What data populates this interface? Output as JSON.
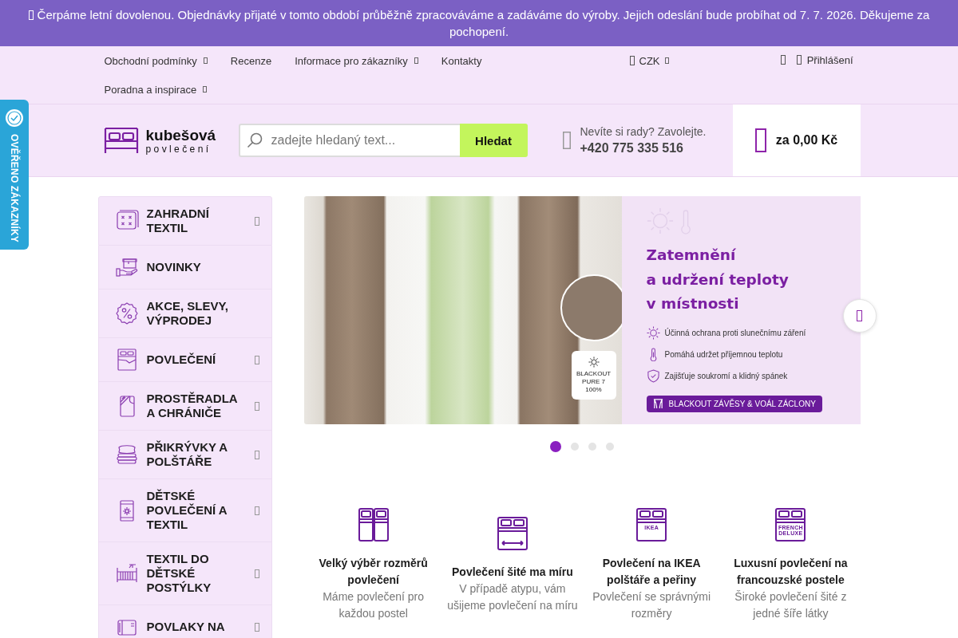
{
  "announcement": {
    "text": "Čerpáme letní dovolenou. Objednávky přijaté v tomto období průběžně zpracováváme a zadáváme do výroby. Jejich odeslání bude probíhat od 7. 7. 2026. Děkujeme za pochopení."
  },
  "top_nav": {
    "links": [
      {
        "label": "Obchodní podmínky",
        "has_submenu": true
      },
      {
        "label": "Recenze",
        "has_submenu": false
      },
      {
        "label": "Informace pro zákazníky",
        "has_submenu": true
      },
      {
        "label": "Kontakty",
        "has_submenu": false
      },
      {
        "label": "Poradna a inspirace",
        "has_submenu": true
      }
    ],
    "currency": "CZK",
    "login": "Přihlášení"
  },
  "verified_tab": {
    "label": "OVĚŘENO ZÁKAZNÍKY"
  },
  "header": {
    "logo": {
      "name": "kubešová",
      "tagline": "povlečení"
    },
    "search": {
      "placeholder": "zadejte hledaný text...",
      "button": "Hledat"
    },
    "contact": {
      "prompt": "Nevíte si rady? Zavolejte.",
      "phone": "+420 775 335 516"
    },
    "cart": {
      "total": "za 0,00 Kč"
    }
  },
  "categories": [
    {
      "kind": "cushion",
      "label": "ZAHRADNÍ TEXTIL",
      "has_submenu": true
    },
    {
      "kind": "parcel",
      "label": "NOVINKY",
      "has_submenu": false
    },
    {
      "kind": "discount",
      "label": "AKCE, SLEVY, VÝPRODEJ",
      "has_submenu": false
    },
    {
      "kind": "bedding",
      "label": "POVLEČENÍ",
      "has_submenu": true
    },
    {
      "kind": "sheet",
      "label": "PROSTĚRADLA A CHRÁNIČE",
      "has_submenu": true
    },
    {
      "kind": "pillows",
      "label": "PŘIKRÝVKY A POLŠTÁŘE",
      "has_submenu": true
    },
    {
      "kind": "kids",
      "label": "DĚTSKÉ POVLEČENÍ A TEXTIL",
      "has_submenu": true
    },
    {
      "kind": "crib",
      "label": "TEXTIL DO DĚTSKÉ POSTÝLKY",
      "has_submenu": true
    },
    {
      "kind": "pillowcase",
      "label": "POVLAKY NA",
      "has_submenu": true
    }
  ],
  "banner": {
    "heading": "Zatemnění\na udržení teploty\nv místnosti",
    "features": [
      {
        "kind": "sun",
        "text": "Účinná ochrana proti slunečnímu záření"
      },
      {
        "kind": "thermometer",
        "text": "Pomáhá udržet příjemnou teplotu"
      },
      {
        "kind": "shield",
        "text": "Zajišťuje soukromí a klidný spánek"
      }
    ],
    "badge": "BLACKOUT\nPURE 7\n100%",
    "cta": "BLACKOUT ZÁVĚSY & VOÁL ZÁCLONY",
    "dots": [
      {
        "selected": true
      },
      {
        "selected": false
      },
      {
        "selected": false
      },
      {
        "selected": false
      }
    ]
  },
  "features": [
    {
      "kind": "twin",
      "title": "Velký výběr rozměrů povlečení",
      "text": "Máme povlečení pro každou postel"
    },
    {
      "kind": "measure",
      "title": "Povlečení šité ma míru",
      "text": "V případě atypu, vám ušijeme povlečení na míru"
    },
    {
      "kind": "labelled",
      "icon_label": "IKEA",
      "title": "Povlečení na IKEA polštáře a peřiny",
      "text": "Povlečení se správnými rozměry"
    },
    {
      "kind": "labelled",
      "icon_label": "FRENCH DELUXE",
      "title": "Luxusní povlečení na francouzské postele",
      "text": "Široké povlečení šité z jedné šíře látky"
    }
  ]
}
